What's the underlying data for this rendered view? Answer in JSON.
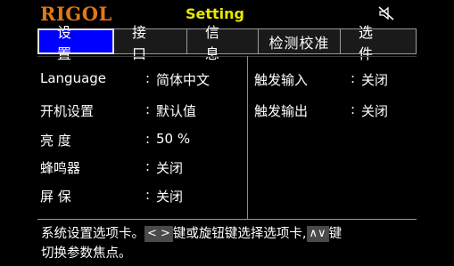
{
  "header": {
    "brand": "RIGOL",
    "title": "Setting",
    "sound_icon": "speaker-muted-icon"
  },
  "tabs": [
    {
      "label": "设 置",
      "active": true
    },
    {
      "label": "接 口",
      "active": false
    },
    {
      "label": "信 息",
      "active": false
    },
    {
      "label": "检测校准",
      "active": false
    },
    {
      "label": "选 件",
      "active": false
    }
  ],
  "settings_left": [
    {
      "label": "Language",
      "value": "简体中文"
    },
    {
      "label": "开机设置",
      "value": "默认值"
    },
    {
      "label": "亮 度",
      "value": "50 %"
    },
    {
      "label": "蜂鸣器",
      "value": "关闭"
    },
    {
      "label": "屏 保",
      "value": "关闭"
    }
  ],
  "settings_right": [
    {
      "label": "触发输入",
      "value": "关闭"
    },
    {
      "label": "触发输出",
      "value": "关闭"
    }
  ],
  "help": {
    "part1": "系统设置选项卡。",
    "key_leftright": "< >",
    "part2": "键或旋钮键选择选项卡,",
    "key_updown": "∧∨",
    "part3": "键",
    "line2": "切换参数焦点。"
  },
  "colors": {
    "brand": "#e07818",
    "title": "#e8e800",
    "active_tab": "#0000ff"
  }
}
